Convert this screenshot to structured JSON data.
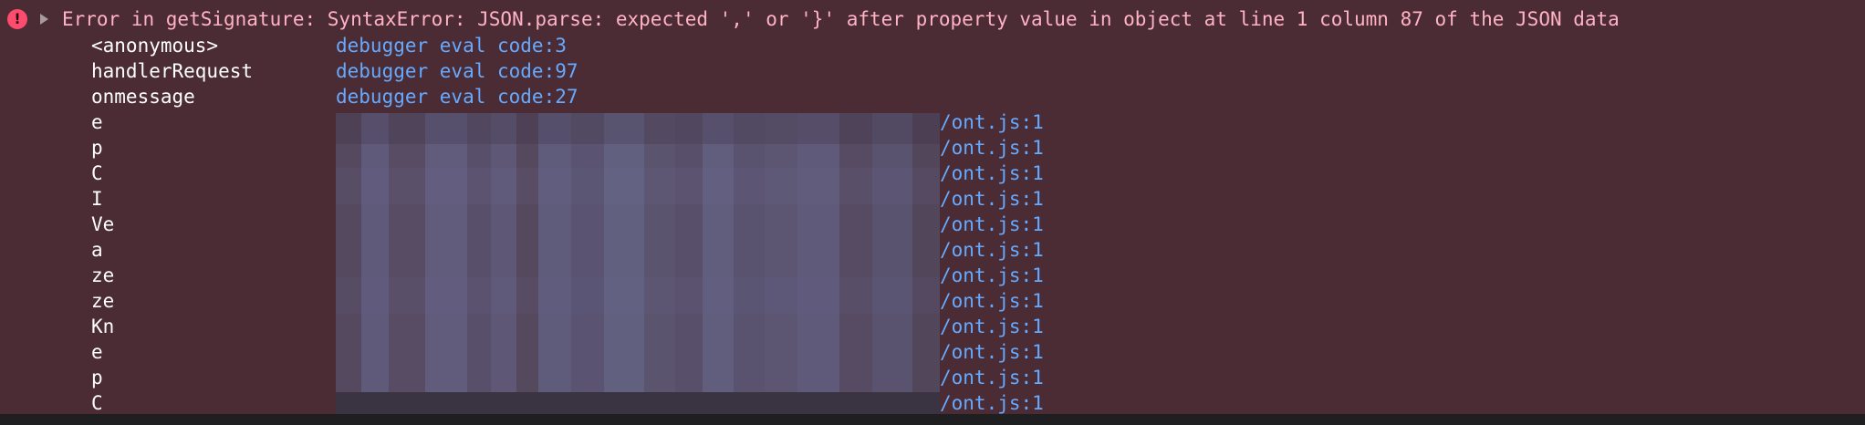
{
  "error": {
    "icon": "error-circle-icon",
    "icon_glyph": "!",
    "message": "Error in getSignature: SyntaxError: JSON.parse: expected ',' or '}' after property value in object at line 1 column 87 of the JSON data"
  },
  "stack": [
    {
      "fn": "<anonymous>",
      "loc": "debugger eval code:3"
    },
    {
      "fn": "handlerRequest",
      "loc": "debugger eval code:97"
    },
    {
      "fn": "onmessage",
      "loc": "debugger eval code:27"
    },
    {
      "fn": "e",
      "loc": "/ont.js:1"
    },
    {
      "fn": "p",
      "loc": "/ont.js:1"
    },
    {
      "fn": "C",
      "loc": "/ont.js:1"
    },
    {
      "fn": "I",
      "loc": "/ont.js:1"
    },
    {
      "fn": "Ve",
      "loc": "/ont.js:1"
    },
    {
      "fn": "a",
      "loc": "/ont.js:1"
    },
    {
      "fn": "ze",
      "loc": "/ont.js:1"
    },
    {
      "fn": "ze",
      "loc": "/ont.js:1"
    },
    {
      "fn": "Kn",
      "loc": "/ont.js:1"
    },
    {
      "fn": "e",
      "loc": "/ont.js:1"
    },
    {
      "fn": "p",
      "loc": "/ont.js:1"
    },
    {
      "fn": "C",
      "loc": "/ont.js:1"
    }
  ],
  "colors": {
    "background": "#4b2b34",
    "error_text": "#ffb3c4",
    "error_icon": "#ff4b6e",
    "function_name": "#ffffff",
    "link": "#66aaff"
  }
}
